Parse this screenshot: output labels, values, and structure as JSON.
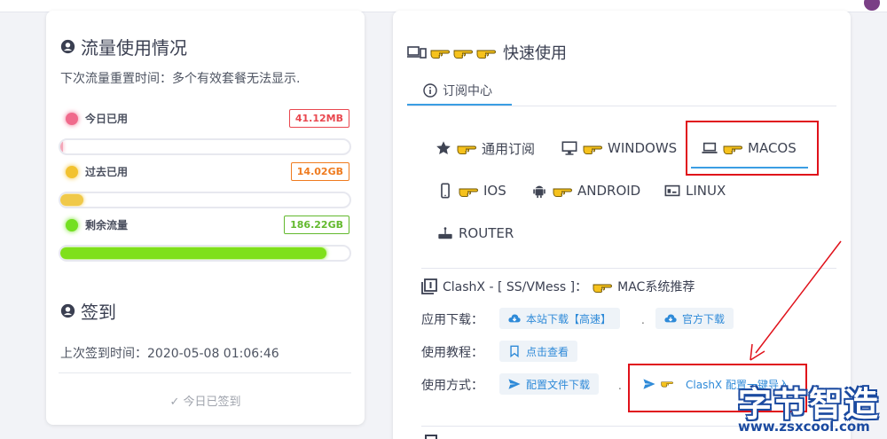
{
  "traffic": {
    "title": "流量使用情况",
    "reset_text": "下次流量重置时间：多个有效套餐无法显示.",
    "stats": [
      {
        "label": "今日已用",
        "value": "41.12MB",
        "dot_color": "#f06a8c",
        "badge_color": "#e9474f",
        "bar_color": "#f4a7b9",
        "fill": 0.01
      },
      {
        "label": "过去已用",
        "value": "14.02GB",
        "dot_color": "#f2c230",
        "badge_color": "#ef7b1f",
        "bar_color": "#f0c94a",
        "fill": 0.08
      },
      {
        "label": "剩余流量",
        "value": "186.22GB",
        "dot_color": "#73e021",
        "badge_color": "#63b92e",
        "bar_color": "#7fe01a",
        "fill": 0.92
      }
    ]
  },
  "checkin": {
    "title": "签到",
    "last_text": "上次签到时间：2020-05-08 01:06:46",
    "status": "今日已签到",
    "status_icon": "✓"
  },
  "quick": {
    "title": "快速使用",
    "subtab": "订阅中心",
    "os_tabs": [
      "通用订阅",
      "WINDOWS",
      "MACOS",
      "IOS",
      "ANDROID",
      "LINUX",
      "ROUTER"
    ],
    "active_tab": "MACOS",
    "client": {
      "name": "ClashX - [ SS/VMess ]：",
      "recommend": "MAC系统推荐",
      "rows": [
        {
          "label": "应用下载：",
          "buttons": [
            "本站下载【高速】",
            "官方下载"
          ]
        },
        {
          "label": "使用教程：",
          "buttons": [
            "点击查看"
          ]
        },
        {
          "label": "使用方式：",
          "buttons": [
            "配置文件下载",
            "ClashX 配置一键导入"
          ]
        }
      ]
    }
  },
  "watermark": {
    "title": "字节智造",
    "url": "www.zsxcool.com"
  },
  "colors": {
    "accent": "#3b9ee3",
    "highlight_red": "#e0111a",
    "hand": "#f6c21d"
  }
}
